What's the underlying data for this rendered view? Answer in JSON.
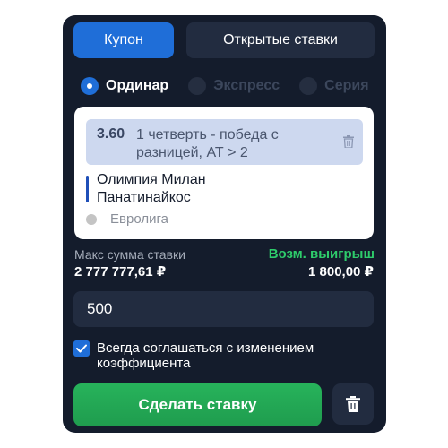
{
  "tabs": {
    "coupon": "Купон",
    "open_bets": "Открытые ставки",
    "active": "coupon"
  },
  "bet_types": [
    {
      "label": "Ординар",
      "selected": true
    },
    {
      "label": "Экспресс",
      "selected": false
    },
    {
      "label": "Серия",
      "selected": false
    }
  ],
  "bet": {
    "odds": "3.60",
    "market": "1 четверть - победа с разницей, АТ > 2",
    "team_home": "Олимпия Милан",
    "team_away": "Панатинайкос",
    "league": "Евролига"
  },
  "stake": {
    "max_label": "Макс сумма ставки",
    "max_value": "2 777 777,61 ₽",
    "win_label": "Возм. выигрыш",
    "win_value": "1 800,00 ₽",
    "amount": "500"
  },
  "accept_changes": {
    "label": "Всегда соглашаться с изменением коэффициента",
    "checked": true
  },
  "actions": {
    "place_bet": "Сделать ставку"
  },
  "colors": {
    "panel": "#141c2c",
    "accent": "#1f6ed8",
    "win": "#2ecc6b",
    "button": "#27b35b"
  },
  "icons": [
    "trash-icon",
    "check-icon"
  ]
}
